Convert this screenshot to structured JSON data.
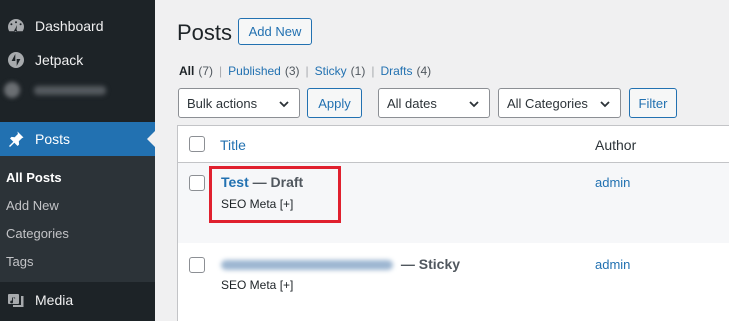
{
  "sidebar": {
    "items": [
      {
        "label": "Dashboard",
        "icon": "dashboard-icon"
      },
      {
        "label": "Jetpack",
        "icon": "jetpack-icon"
      },
      {
        "label": "Posts",
        "icon": "pin-icon"
      },
      {
        "label": "Media",
        "icon": "media-icon"
      }
    ],
    "submenu": [
      "All Posts",
      "Add New",
      "Categories",
      "Tags"
    ]
  },
  "header": {
    "title": "Posts",
    "add_new_label": "Add New"
  },
  "views": [
    {
      "label": "All",
      "count": "(7)"
    },
    {
      "label": "Published",
      "count": "(3)"
    },
    {
      "label": "Sticky",
      "count": "(1)"
    },
    {
      "label": "Drafts",
      "count": "(4)"
    }
  ],
  "filters": {
    "bulk_actions": "Bulk actions",
    "apply_label": "Apply",
    "dates": "All dates",
    "categories": "All Categories",
    "filter_label": "Filter"
  },
  "table": {
    "columns": {
      "title": "Title",
      "author": "Author"
    },
    "rows": [
      {
        "title": "Test",
        "state": "— Draft",
        "seo": "SEO Meta [+]",
        "author": "admin"
      },
      {
        "title": "",
        "state": "— Sticky",
        "seo": "SEO Meta [+]",
        "author": "admin"
      }
    ]
  },
  "colors": {
    "accent": "#2271b1",
    "sidebar_bg": "#1d2327",
    "highlight": "#e0202e"
  }
}
